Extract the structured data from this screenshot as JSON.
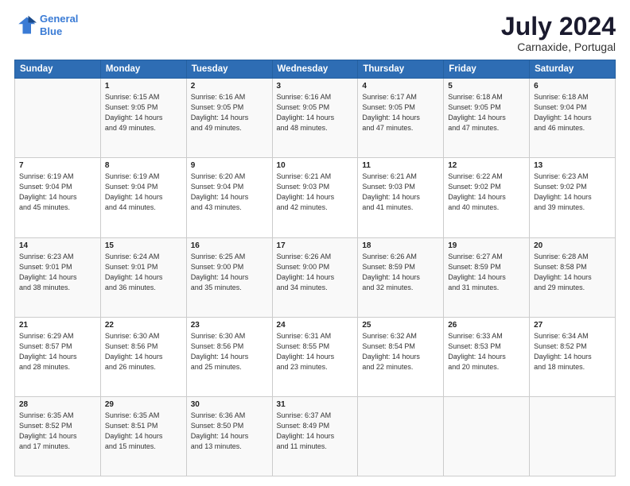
{
  "header": {
    "logo_line1": "General",
    "logo_line2": "Blue",
    "title": "July 2024",
    "location": "Carnaxide, Portugal"
  },
  "weekdays": [
    "Sunday",
    "Monday",
    "Tuesday",
    "Wednesday",
    "Thursday",
    "Friday",
    "Saturday"
  ],
  "weeks": [
    [
      {
        "num": "",
        "info": ""
      },
      {
        "num": "1",
        "info": "Sunrise: 6:15 AM\nSunset: 9:05 PM\nDaylight: 14 hours\nand 49 minutes."
      },
      {
        "num": "2",
        "info": "Sunrise: 6:16 AM\nSunset: 9:05 PM\nDaylight: 14 hours\nand 49 minutes."
      },
      {
        "num": "3",
        "info": "Sunrise: 6:16 AM\nSunset: 9:05 PM\nDaylight: 14 hours\nand 48 minutes."
      },
      {
        "num": "4",
        "info": "Sunrise: 6:17 AM\nSunset: 9:05 PM\nDaylight: 14 hours\nand 47 minutes."
      },
      {
        "num": "5",
        "info": "Sunrise: 6:18 AM\nSunset: 9:05 PM\nDaylight: 14 hours\nand 47 minutes."
      },
      {
        "num": "6",
        "info": "Sunrise: 6:18 AM\nSunset: 9:04 PM\nDaylight: 14 hours\nand 46 minutes."
      }
    ],
    [
      {
        "num": "7",
        "info": "Sunrise: 6:19 AM\nSunset: 9:04 PM\nDaylight: 14 hours\nand 45 minutes."
      },
      {
        "num": "8",
        "info": "Sunrise: 6:19 AM\nSunset: 9:04 PM\nDaylight: 14 hours\nand 44 minutes."
      },
      {
        "num": "9",
        "info": "Sunrise: 6:20 AM\nSunset: 9:04 PM\nDaylight: 14 hours\nand 43 minutes."
      },
      {
        "num": "10",
        "info": "Sunrise: 6:21 AM\nSunset: 9:03 PM\nDaylight: 14 hours\nand 42 minutes."
      },
      {
        "num": "11",
        "info": "Sunrise: 6:21 AM\nSunset: 9:03 PM\nDaylight: 14 hours\nand 41 minutes."
      },
      {
        "num": "12",
        "info": "Sunrise: 6:22 AM\nSunset: 9:02 PM\nDaylight: 14 hours\nand 40 minutes."
      },
      {
        "num": "13",
        "info": "Sunrise: 6:23 AM\nSunset: 9:02 PM\nDaylight: 14 hours\nand 39 minutes."
      }
    ],
    [
      {
        "num": "14",
        "info": "Sunrise: 6:23 AM\nSunset: 9:01 PM\nDaylight: 14 hours\nand 38 minutes."
      },
      {
        "num": "15",
        "info": "Sunrise: 6:24 AM\nSunset: 9:01 PM\nDaylight: 14 hours\nand 36 minutes."
      },
      {
        "num": "16",
        "info": "Sunrise: 6:25 AM\nSunset: 9:00 PM\nDaylight: 14 hours\nand 35 minutes."
      },
      {
        "num": "17",
        "info": "Sunrise: 6:26 AM\nSunset: 9:00 PM\nDaylight: 14 hours\nand 34 minutes."
      },
      {
        "num": "18",
        "info": "Sunrise: 6:26 AM\nSunset: 8:59 PM\nDaylight: 14 hours\nand 32 minutes."
      },
      {
        "num": "19",
        "info": "Sunrise: 6:27 AM\nSunset: 8:59 PM\nDaylight: 14 hours\nand 31 minutes."
      },
      {
        "num": "20",
        "info": "Sunrise: 6:28 AM\nSunset: 8:58 PM\nDaylight: 14 hours\nand 29 minutes."
      }
    ],
    [
      {
        "num": "21",
        "info": "Sunrise: 6:29 AM\nSunset: 8:57 PM\nDaylight: 14 hours\nand 28 minutes."
      },
      {
        "num": "22",
        "info": "Sunrise: 6:30 AM\nSunset: 8:56 PM\nDaylight: 14 hours\nand 26 minutes."
      },
      {
        "num": "23",
        "info": "Sunrise: 6:30 AM\nSunset: 8:56 PM\nDaylight: 14 hours\nand 25 minutes."
      },
      {
        "num": "24",
        "info": "Sunrise: 6:31 AM\nSunset: 8:55 PM\nDaylight: 14 hours\nand 23 minutes."
      },
      {
        "num": "25",
        "info": "Sunrise: 6:32 AM\nSunset: 8:54 PM\nDaylight: 14 hours\nand 22 minutes."
      },
      {
        "num": "26",
        "info": "Sunrise: 6:33 AM\nSunset: 8:53 PM\nDaylight: 14 hours\nand 20 minutes."
      },
      {
        "num": "27",
        "info": "Sunrise: 6:34 AM\nSunset: 8:52 PM\nDaylight: 14 hours\nand 18 minutes."
      }
    ],
    [
      {
        "num": "28",
        "info": "Sunrise: 6:35 AM\nSunset: 8:52 PM\nDaylight: 14 hours\nand 17 minutes."
      },
      {
        "num": "29",
        "info": "Sunrise: 6:35 AM\nSunset: 8:51 PM\nDaylight: 14 hours\nand 15 minutes."
      },
      {
        "num": "30",
        "info": "Sunrise: 6:36 AM\nSunset: 8:50 PM\nDaylight: 14 hours\nand 13 minutes."
      },
      {
        "num": "31",
        "info": "Sunrise: 6:37 AM\nSunset: 8:49 PM\nDaylight: 14 hours\nand 11 minutes."
      },
      {
        "num": "",
        "info": ""
      },
      {
        "num": "",
        "info": ""
      },
      {
        "num": "",
        "info": ""
      }
    ]
  ]
}
